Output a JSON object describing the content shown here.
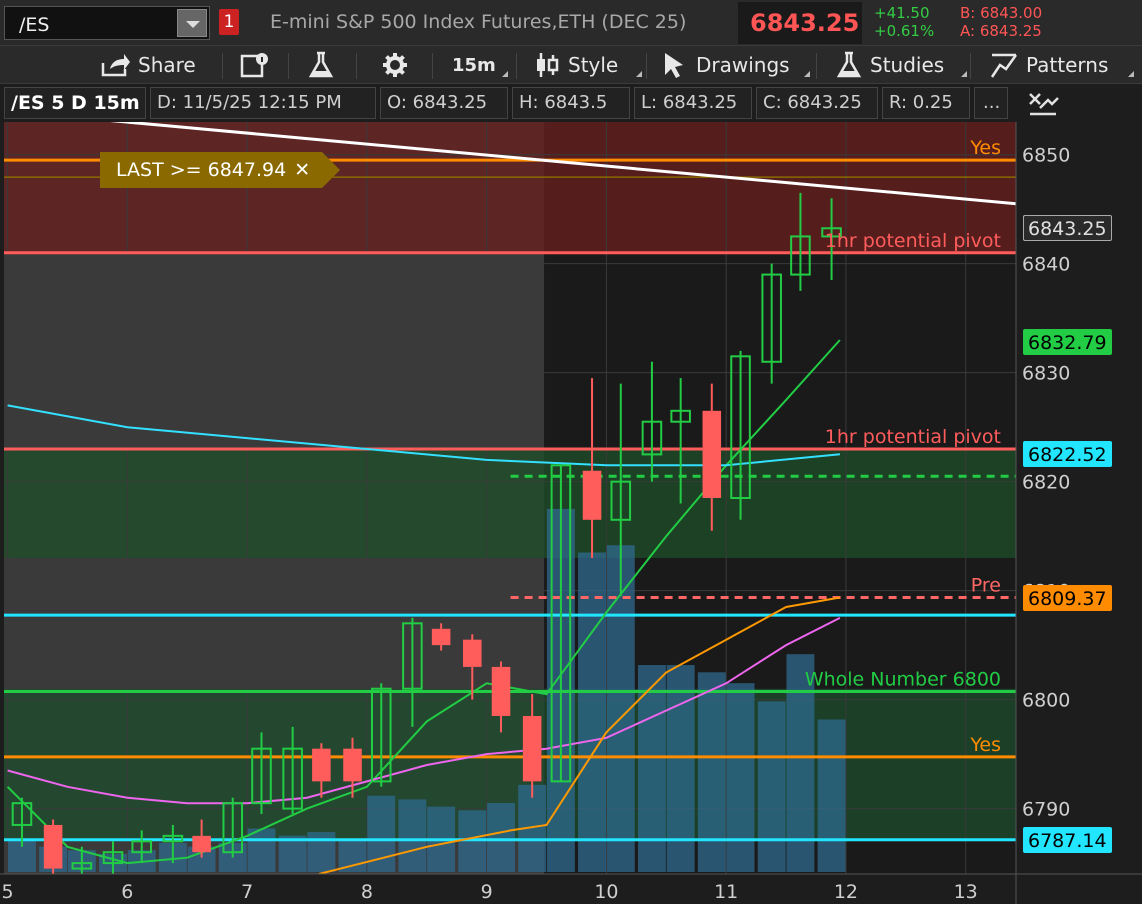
{
  "header": {
    "symbol": "/ES",
    "link_badge": "1",
    "description": "E-mini S&P 500 Index Futures,ETH (DEC 25)",
    "last": "6843.25",
    "change": "+41.50",
    "change_pct": "+0.61%",
    "bid": "B: 6843.00",
    "ask": "A: 6843.25"
  },
  "toolbar": {
    "share": "Share",
    "timeframe": "15m",
    "style": "Style",
    "drawings": "Drawings",
    "studies": "Studies",
    "patterns": "Patterns"
  },
  "info": {
    "symbol_period": "/ES 5 D 15m",
    "date": "D: 11/5/25 12:15 PM",
    "open": "O: 6843.25",
    "high": "H: 6843.5",
    "low": "L: 6843.25",
    "close": "C: 6843.25",
    "range": "R: 0.25",
    "more": "..."
  },
  "chart": {
    "alert": "LAST >= 6847.94"
  },
  "chart_data": {
    "type": "candlestick",
    "y_range": [
      6784,
      6853
    ],
    "x_range": [
      4.97,
      13.42
    ],
    "y_ticks": [
      "6790",
      "6800",
      "6810",
      "6820",
      "6830",
      "6840",
      "6850"
    ],
    "x_ticks": [
      {
        "x": 5,
        "label": "5"
      },
      {
        "x": 6,
        "label": "6"
      },
      {
        "x": 7,
        "label": "7"
      },
      {
        "x": 8,
        "label": "8"
      },
      {
        "x": 9,
        "label": "9"
      },
      {
        "x": 10,
        "label": "10"
      },
      {
        "x": 11,
        "label": "11"
      },
      {
        "x": 12,
        "label": "12"
      },
      {
        "x": 13,
        "label": "13"
      }
    ],
    "candles": [
      {
        "t": 5.12,
        "o": 6788.5,
        "h": 6791.0,
        "l": 6786.5,
        "c": 6790.5
      },
      {
        "t": 5.38,
        "o": 6788.5,
        "h": 6789.0,
        "l": 6783.0,
        "c": 6784.5
      },
      {
        "t": 5.62,
        "o": 6784.5,
        "h": 6786.5,
        "l": 6783.0,
        "c": 6785.0
      },
      {
        "t": 5.88,
        "o": 6785.0,
        "h": 6787.0,
        "l": 6783.5,
        "c": 6786.0
      },
      {
        "t": 6.12,
        "o": 6786.0,
        "h": 6788.0,
        "l": 6785.0,
        "c": 6787.0
      },
      {
        "t": 6.38,
        "o": 6787.0,
        "h": 6788.5,
        "l": 6785.0,
        "c": 6787.5
      },
      {
        "t": 6.62,
        "o": 6787.5,
        "h": 6789.0,
        "l": 6785.5,
        "c": 6786.0
      },
      {
        "t": 6.88,
        "o": 6786.0,
        "h": 6791.0,
        "l": 6785.5,
        "c": 6790.5
      },
      {
        "t": 7.12,
        "o": 6790.5,
        "h": 6797.0,
        "l": 6789.5,
        "c": 6795.5
      },
      {
        "t": 7.38,
        "o": 6790.0,
        "h": 6797.5,
        "l": 6789.5,
        "c": 6795.5
      },
      {
        "t": 7.62,
        "o": 6795.5,
        "h": 6796.0,
        "l": 6791.0,
        "c": 6792.5
      },
      {
        "t": 7.88,
        "o": 6795.5,
        "h": 6796.5,
        "l": 6791.0,
        "c": 6792.5
      },
      {
        "t": 8.12,
        "o": 6792.5,
        "h": 6801.5,
        "l": 6792.0,
        "c": 6801.0
      },
      {
        "t": 8.38,
        "o": 6801.0,
        "h": 6807.5,
        "l": 6797.5,
        "c": 6807.0
      },
      {
        "t": 8.62,
        "o": 6806.5,
        "h": 6807.0,
        "l": 6804.5,
        "c": 6805.0
      },
      {
        "t": 8.88,
        "o": 6805.5,
        "h": 6806.0,
        "l": 6800.0,
        "c": 6803.0
      },
      {
        "t": 9.12,
        "o": 6803.0,
        "h": 6803.5,
        "l": 6797.0,
        "c": 6798.5
      },
      {
        "t": 9.38,
        "o": 6798.5,
        "h": 6800.5,
        "l": 6791.0,
        "c": 6792.5
      },
      {
        "t": 9.62,
        "o": 6792.5,
        "h": 6821.5,
        "l": 6792.5,
        "c": 6821.5
      },
      {
        "t": 9.88,
        "o": 6821.0,
        "h": 6829.5,
        "l": 6813.0,
        "c": 6816.5
      },
      {
        "t": 10.12,
        "o": 6816.5,
        "h": 6829.0,
        "l": 6809.5,
        "c": 6820.0
      },
      {
        "t": 10.38,
        "o": 6822.5,
        "h": 6831.0,
        "l": 6820.0,
        "c": 6825.5
      },
      {
        "t": 10.62,
        "o": 6825.5,
        "h": 6829.5,
        "l": 6818.0,
        "c": 6826.5
      },
      {
        "t": 10.88,
        "o": 6826.5,
        "h": 6829.0,
        "l": 6815.5,
        "c": 6818.5
      },
      {
        "t": 11.12,
        "o": 6818.5,
        "h": 6832.0,
        "l": 6816.5,
        "c": 6831.5
      },
      {
        "t": 11.38,
        "o": 6831.0,
        "h": 6840.0,
        "l": 6829.0,
        "c": 6839.0
      },
      {
        "t": 11.62,
        "o": 6839.0,
        "h": 6846.5,
        "l": 6837.5,
        "c": 6842.5
      },
      {
        "t": 11.88,
        "o": 6842.5,
        "h": 6846.0,
        "l": 6838.5,
        "c": 6843.25
      }
    ],
    "volume": [
      {
        "t": 5.12,
        "v": 0.09
      },
      {
        "t": 5.38,
        "v": 0.07
      },
      {
        "t": 5.62,
        "v": 0.06
      },
      {
        "t": 5.88,
        "v": 0.05
      },
      {
        "t": 6.12,
        "v": 0.06
      },
      {
        "t": 6.38,
        "v": 0.08
      },
      {
        "t": 6.62,
        "v": 0.07
      },
      {
        "t": 6.88,
        "v": 0.08
      },
      {
        "t": 7.12,
        "v": 0.12
      },
      {
        "t": 7.38,
        "v": 0.1
      },
      {
        "t": 7.62,
        "v": 0.11
      },
      {
        "t": 7.88,
        "v": 0.09
      },
      {
        "t": 8.12,
        "v": 0.21
      },
      {
        "t": 8.38,
        "v": 0.2
      },
      {
        "t": 8.62,
        "v": 0.18
      },
      {
        "t": 8.88,
        "v": 0.17
      },
      {
        "t": 9.12,
        "v": 0.19
      },
      {
        "t": 9.38,
        "v": 0.24
      },
      {
        "t": 9.62,
        "v": 1.0
      },
      {
        "t": 9.88,
        "v": 0.88
      },
      {
        "t": 10.12,
        "v": 0.9
      },
      {
        "t": 10.38,
        "v": 0.57
      },
      {
        "t": 10.62,
        "v": 0.57
      },
      {
        "t": 10.88,
        "v": 0.55
      },
      {
        "t": 11.12,
        "v": 0.52
      },
      {
        "t": 11.38,
        "v": 0.47
      },
      {
        "t": 11.62,
        "v": 0.6
      },
      {
        "t": 11.88,
        "v": 0.42
      }
    ],
    "zones": [
      {
        "from": 6841,
        "to": 6853,
        "color": "#6b1f1f"
      },
      {
        "from": 6813,
        "to": 6823,
        "color": "#1f4f2a"
      },
      {
        "from": 6787,
        "to": 6801,
        "color": "#1c4d2c"
      }
    ],
    "horizontal_lines": [
      {
        "price": 6849.5,
        "color": "#ff8c00",
        "label": "Yes",
        "dash": false
      },
      {
        "price": 6847.94,
        "color": "#8a6a00",
        "label": "",
        "dash": false
      },
      {
        "price": 6841.0,
        "color": "#ff5c5c",
        "label": "1hr potential pivot",
        "dash": false
      },
      {
        "price": 6823.0,
        "color": "#ff5c5c",
        "label": "1hr potential pivot",
        "dash": false
      },
      {
        "price": 6820.5,
        "color": "#22cc44",
        "label": "",
        "dash": true
      },
      {
        "price": 6809.37,
        "color": "#ff6666",
        "label": "Pre",
        "dash": true
      },
      {
        "price": 6807.75,
        "color": "#22e5ff",
        "label": "",
        "dash": false
      },
      {
        "price": 6800.75,
        "color": "#22cc44",
        "label": "Whole Number 6800",
        "dash": false
      },
      {
        "price": 6794.75,
        "color": "#ff8c00",
        "label": "Yes",
        "dash": false
      },
      {
        "price": 6787.14,
        "color": "#22e5ff",
        "label": "",
        "dash": false
      }
    ],
    "moving_averages": [
      {
        "name": "",
        "color": "#22cc44",
        "points": [
          [
            5.0,
            6792.0
          ],
          [
            5.5,
            6786.5
          ],
          [
            6.0,
            6785.0
          ],
          [
            6.5,
            6785.5
          ],
          [
            7.0,
            6787.5
          ],
          [
            7.5,
            6790.0
          ],
          [
            8.0,
            6792.0
          ],
          [
            8.5,
            6798.0
          ],
          [
            9.0,
            6801.5
          ],
          [
            9.5,
            6800.5
          ],
          [
            10.0,
            6808.0
          ],
          [
            10.5,
            6815.0
          ],
          [
            11.0,
            6821.5
          ],
          [
            11.5,
            6827.5
          ],
          [
            11.95,
            6833.0
          ]
        ]
      },
      {
        "name": "",
        "color": "#ee66ee",
        "points": [
          [
            5.0,
            6793.5
          ],
          [
            5.5,
            6792.0
          ],
          [
            6.0,
            6791.0
          ],
          [
            6.5,
            6790.5
          ],
          [
            7.0,
            6790.5
          ],
          [
            7.5,
            6791.0
          ],
          [
            8.0,
            6792.5
          ],
          [
            8.5,
            6794.0
          ],
          [
            9.0,
            6795.0
          ],
          [
            9.5,
            6795.5
          ],
          [
            10.0,
            6796.5
          ],
          [
            10.5,
            6799.0
          ],
          [
            11.0,
            6801.5
          ],
          [
            11.5,
            6805.0
          ],
          [
            11.95,
            6807.5
          ]
        ]
      },
      {
        "name": "",
        "color": "#ff9900",
        "points": [
          [
            7.6,
            6784.0
          ],
          [
            8.5,
            6786.5
          ],
          [
            9.2,
            6788.0
          ],
          [
            9.5,
            6788.5
          ],
          [
            10.0,
            6797.0
          ],
          [
            10.5,
            6802.5
          ],
          [
            11.0,
            6805.5
          ],
          [
            11.5,
            6808.5
          ],
          [
            11.95,
            6809.37
          ]
        ]
      },
      {
        "name": "",
        "color": "#33e0ff",
        "points": [
          [
            5.0,
            6827.0
          ],
          [
            6.0,
            6825.0
          ],
          [
            7.0,
            6824.0
          ],
          [
            8.0,
            6823.0
          ],
          [
            9.0,
            6822.0
          ],
          [
            10.0,
            6821.5
          ],
          [
            11.0,
            6821.5
          ],
          [
            11.95,
            6822.52
          ]
        ]
      },
      {
        "name": "",
        "color": "#ffffff",
        "points": [
          [
            5.5,
            6853.5
          ],
          [
            13.42,
            6845.5
          ]
        ]
      }
    ],
    "price_tags": [
      {
        "price": 6843.25,
        "text": "6843.25",
        "bg": "#2a2a2a",
        "fg": "#e0e0e0",
        "border": "#aaaaaa"
      },
      {
        "price": 6832.79,
        "text": "6832.79",
        "bg": "#22cc44",
        "fg": "#000000",
        "border": "#22cc44"
      },
      {
        "price": 6822.52,
        "text": "6822.52",
        "bg": "#22e5ff",
        "fg": "#000000",
        "border": "#22e5ff"
      },
      {
        "price": 6809.37,
        "text": "6809.37",
        "bg": "#ff8c00",
        "fg": "#000000",
        "border": "#ff8c00"
      },
      {
        "price": 6787.14,
        "text": "6787.14",
        "bg": "#22e5ff",
        "fg": "#000000",
        "border": "#22e5ff"
      }
    ],
    "colors": {
      "up": "#22cc44",
      "down": "#ff5c5c",
      "volume": "#2f6a8f",
      "background_pre": "#3a3a3a",
      "background_session": "#1a1a1a"
    }
  }
}
